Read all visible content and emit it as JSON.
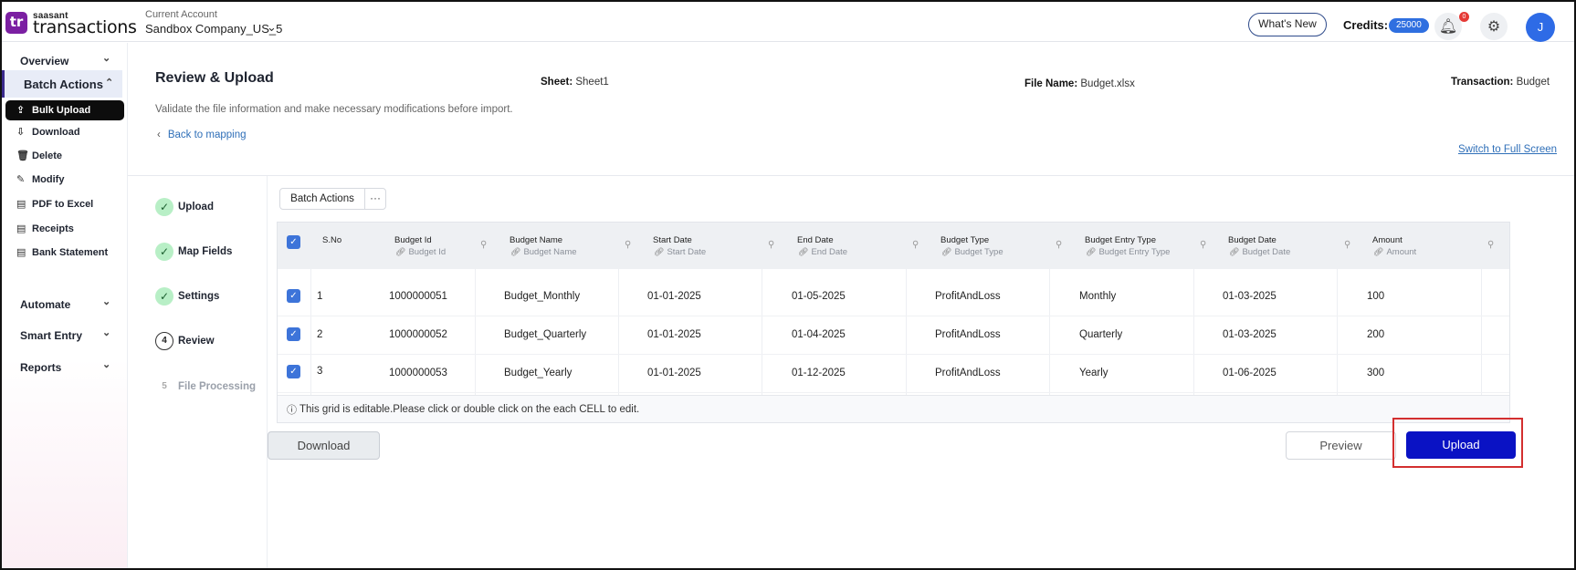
{
  "header": {
    "logo_mark": "tr",
    "logo_small": "saasant",
    "logo_big": "transactions",
    "account_label": "Current Account",
    "account_name": "Sandbox Company_US_5",
    "whats_new": "What's New",
    "credits_label": "Credits:",
    "credits_value": "25000",
    "notification_count": "0",
    "avatar_initial": "J"
  },
  "sidebar": {
    "overview": "Overview",
    "batch_actions": "Batch Actions",
    "sub_items": [
      {
        "label": "Bulk Upload",
        "icon": "upload-cloud-icon"
      },
      {
        "label": "Download",
        "icon": "download-cloud-icon"
      },
      {
        "label": "Delete",
        "icon": "trash-icon"
      },
      {
        "label": "Modify",
        "icon": "edit-icon"
      },
      {
        "label": "PDF to Excel",
        "icon": "pdf-icon"
      },
      {
        "label": "Receipts",
        "icon": "receipt-icon"
      },
      {
        "label": "Bank Statement",
        "icon": "document-icon"
      }
    ],
    "automate": "Automate",
    "smart_entry": "Smart Entry",
    "reports": "Reports"
  },
  "main": {
    "title": "Review & Upload",
    "sheet_label": "Sheet:",
    "sheet_value": "Sheet1",
    "file_label": "File Name:",
    "file_value": "Budget.xlsx",
    "transaction_label": "Transaction:",
    "transaction_value": "Budget",
    "subtitle": "Validate the file information and make necessary modifications before import.",
    "back_link": "Back to mapping",
    "fullscreen_link": "Switch to Full Screen"
  },
  "steps": [
    {
      "label": "Upload",
      "state": "done",
      "marker": "✓"
    },
    {
      "label": "Map Fields",
      "state": "done",
      "marker": "✓"
    },
    {
      "label": "Settings",
      "state": "done",
      "marker": "✓"
    },
    {
      "label": "Review",
      "state": "current",
      "marker": "4"
    },
    {
      "label": "File Processing",
      "state": "pending",
      "marker": "5"
    }
  ],
  "toolbar": {
    "batch_actions": "Batch Actions",
    "more": "···"
  },
  "grid": {
    "columns": [
      {
        "title": "S.No",
        "sub": ""
      },
      {
        "title": "Budget Id",
        "sub": "Budget Id"
      },
      {
        "title": "Budget Name",
        "sub": "Budget Name"
      },
      {
        "title": "Start Date",
        "sub": "Start Date"
      },
      {
        "title": "End Date",
        "sub": "End Date"
      },
      {
        "title": "Budget Type",
        "sub": "Budget Type"
      },
      {
        "title": "Budget Entry Type",
        "sub": "Budget Entry Type"
      },
      {
        "title": "Budget Date",
        "sub": "Budget Date"
      },
      {
        "title": "Amount",
        "sub": "Amount"
      }
    ],
    "rows": [
      [
        "1",
        "1000000051",
        "Budget_Monthly",
        "01-01-2025",
        "01-05-2025",
        "ProfitAndLoss",
        "Monthly",
        "01-03-2025",
        "100"
      ],
      [
        "2",
        "1000000052",
        "Budget_Quarterly",
        "01-01-2025",
        "01-04-2025",
        "ProfitAndLoss",
        "Quarterly",
        "01-03-2025",
        "200"
      ],
      [
        "3",
        "1000000053",
        "Budget_Yearly",
        "01-01-2025",
        "01-12-2025",
        "ProfitAndLoss",
        "Yearly",
        "01-06-2025",
        "300"
      ]
    ],
    "note": "This grid is editable.Please click or double click on the each CELL to edit."
  },
  "actions": {
    "download": "Download",
    "preview": "Preview",
    "upload": "Upload"
  },
  "colors": {
    "brand": "#7b1fa2",
    "accent": "#3d74d9",
    "upload_button": "#0a12c4",
    "highlight": "#d32f2f"
  }
}
